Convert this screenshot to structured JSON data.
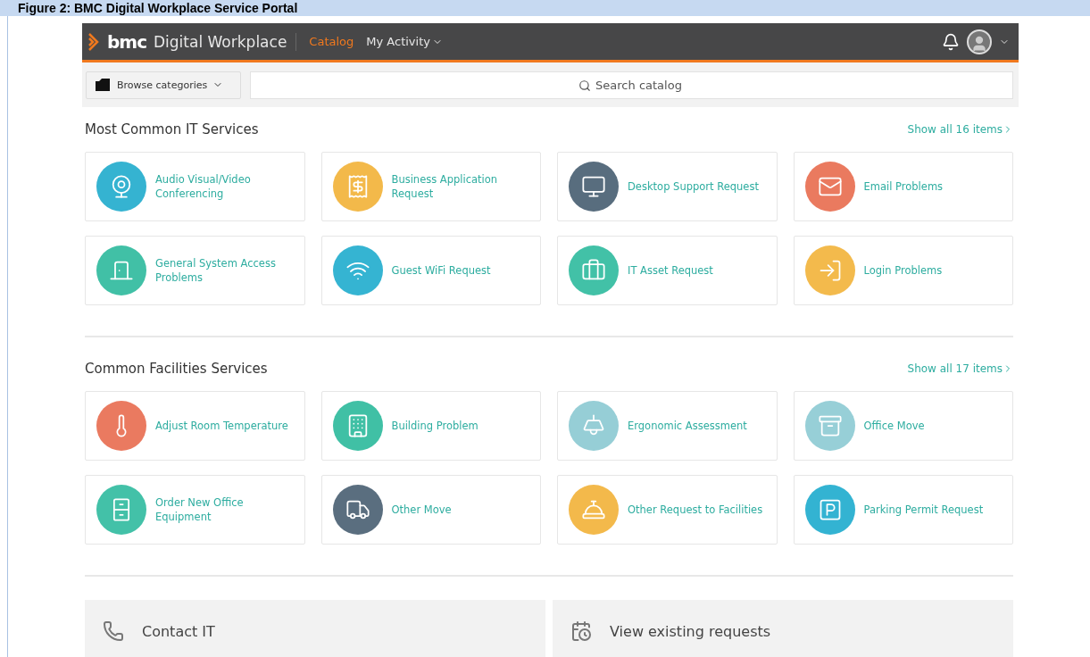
{
  "caption": "Figure 2: BMC Digital Workplace Service Portal",
  "header": {
    "brand": "bmc",
    "product": "Digital Workplace",
    "nav": [
      {
        "label": "Catalog",
        "selected": true
      },
      {
        "label": "My Activity",
        "selected": false,
        "dropdown": true
      }
    ]
  },
  "toolbar": {
    "browse": "Browse categories",
    "search": {
      "placeholder": "Search catalog"
    }
  },
  "sections": [
    {
      "title": "Most Common IT Services",
      "show_all": "Show all 16 items",
      "items": [
        {
          "label": "Audio Visual/Video Conferencing",
          "color": "#35b3d1"
        },
        {
          "label": "Business Application Request",
          "color": "#f3b94a"
        },
        {
          "label": "Desktop Support Request",
          "color": "#586d7e"
        },
        {
          "label": "Email Problems",
          "color": "#ea7a5f"
        },
        {
          "label": "General System Access Problems",
          "color": "#41c0a6"
        },
        {
          "label": "Guest WiFi Request",
          "color": "#35b4d2"
        },
        {
          "label": "IT Asset Request",
          "color": "#42c1a7"
        },
        {
          "label": "Login Problems",
          "color": "#f3ba4c"
        }
      ]
    },
    {
      "title": "Common Facilities Services",
      "show_all": "Show all 17 items",
      "items": [
        {
          "label": "Adjust Room Temperature",
          "color": "#ea7a60"
        },
        {
          "label": "Building Problem",
          "color": "#40c0a5"
        },
        {
          "label": "Ergonomic Assessment",
          "color": "#96ced6"
        },
        {
          "label": "Office Move",
          "color": "#97cfd7"
        },
        {
          "label": "Order New Office Equipment",
          "color": "#43c1a8"
        },
        {
          "label": "Other Move",
          "color": "#5a6e7f"
        },
        {
          "label": "Other Request to Facilities",
          "color": "#f3b94b"
        },
        {
          "label": "Parking Permit Request",
          "color": "#33b3d2"
        }
      ]
    }
  ],
  "footer": [
    {
      "label": "Contact IT"
    },
    {
      "label": "View existing requests"
    }
  ]
}
